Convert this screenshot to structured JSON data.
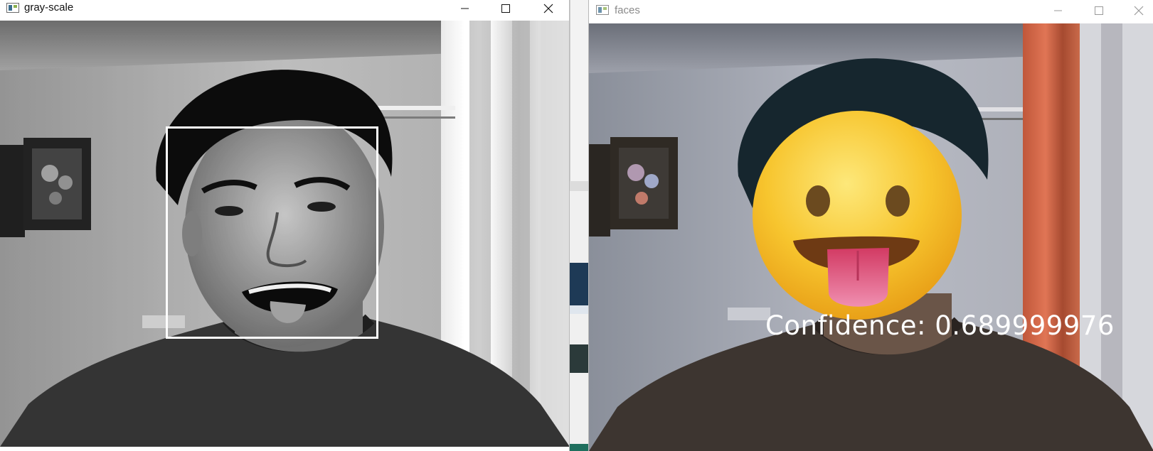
{
  "windows": {
    "gray": {
      "title": "gray-scale",
      "icon": "opencv-window-icon",
      "controls": [
        "minimize-icon",
        "maximize-icon",
        "close-icon"
      ],
      "overlay": "face-rectangle"
    },
    "faces": {
      "title": "faces",
      "icon": "opencv-window-icon",
      "controls": [
        "minimize-icon",
        "maximize-icon",
        "close-icon"
      ],
      "overlay_emoji": "stuck-out-tongue-emoji",
      "label_text": "Confidence: 0.689999976"
    }
  },
  "colors": {
    "titlebar_bg": "#ffffff",
    "faces_title_text": "#8a8a8a",
    "face_box": "#ffffff",
    "emoji_yellow": "#f7c52e",
    "tongue": "#e2557f"
  }
}
